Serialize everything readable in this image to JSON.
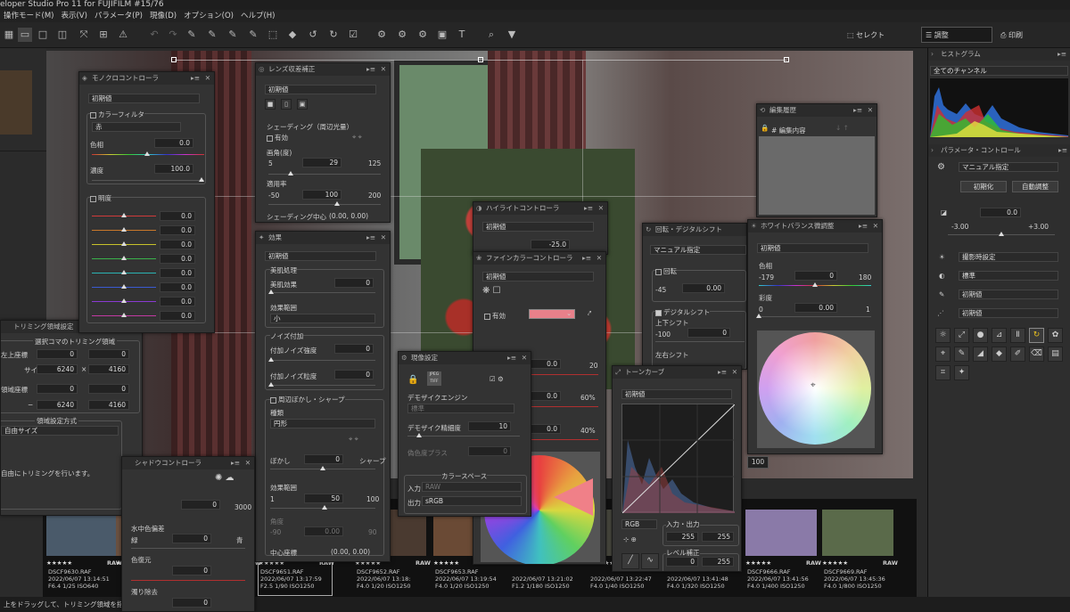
{
  "app": {
    "title": "eloper Studio Pro 11 for FUJIFILM  #15/76"
  },
  "menu": [
    "操作モード(M)",
    "表示(V)",
    "パラメータ(P)",
    "現像(D)",
    "オプション(O)",
    "ヘルプ(H)"
  ],
  "toolbar": {
    "select": "セレクト",
    "adjust": "調整",
    "print": "印刷"
  },
  "trim": {
    "title": "トリミング領域設定",
    "section": "選択コマのトリミング領域",
    "tl": "左上座標",
    "size": "サイズ",
    "tl_x": "0",
    "tl_y": "0",
    "w": "6240",
    "h": "4160",
    "area": "領域座標",
    "ax": "0",
    "ay": "0",
    "ax2": "6240",
    "ay2": "4160",
    "method_title": "領域設定方式",
    "method": "自由サイズ",
    "note": "自由にトリミングを行います。",
    "x": "×",
    "dash": "−"
  },
  "mono": {
    "title": "モノクロコントローラ",
    "preset": "初期値",
    "color_filter": "カラーフィルタ",
    "filter": "赤",
    "hue": "色相",
    "hue_v": "0.0",
    "density": "濃度",
    "density_v": "100.0",
    "brightness": "明度",
    "bvals": [
      "0.0",
      "0.0",
      "0.0",
      "0.0",
      "0.0",
      "0.0",
      "0.0",
      "0.0"
    ],
    "bcolors": [
      "#d03a3a",
      "#c8782a",
      "#c8c22a",
      "#3ab24a",
      "#2ab2b2",
      "#3a5ad2",
      "#8a3ad2",
      "#c23aa2"
    ]
  },
  "lens": {
    "title": "レンズ収差補正",
    "preset": "初期値",
    "shading": "シェーディング（周辺光量）",
    "enabled": "有効",
    "angle": "画角(度)",
    "min": "5",
    "val": "29",
    "max": "125",
    "rate": "適用率",
    "rmin": "-50",
    "rval": "100",
    "rmax": "200",
    "center": "シェーディング中心",
    "center_v": "(0.00, 0.00)"
  },
  "effect": {
    "title": "効果",
    "preset": "初期値",
    "skin": "美肌処理",
    "skin_effect": "美肌効果",
    "skin_v": "0",
    "skin_range": "効果範囲",
    "skin_range_v": "小",
    "noise": "ノイズ付加",
    "noise_str": "付加ノイズ強度",
    "noise_str_v": "0",
    "noise_gr": "付加ノイズ粒度",
    "noise_gr_v": "0",
    "blur": "周辺ぼかし・シャープ",
    "type": "種類",
    "type_v": "円形",
    "bokashi": "ぼかし",
    "sharp": "シャープ",
    "bv": "0",
    "range": "効果範囲",
    "r1": "1",
    "r50": "50",
    "r100": "100",
    "angle": "角度",
    "a1": "-90",
    "av": "0.00",
    "a2": "90",
    "center": "中心座標",
    "center_v": "(0.00, 0.00)"
  },
  "highlight": {
    "title": "ハイライトコントローラ",
    "preset": "初期値",
    "v": "-25.0"
  },
  "finecolor": {
    "title": "ファインカラーコントローラ",
    "preset": "初期値",
    "enabled": "有効",
    "swatch": "#e8808a",
    "v1": "0.0",
    "v1max": "20",
    "v2": "0.0",
    "v2max": "60%",
    "v3": "0.0",
    "v3max": "40%"
  },
  "develop": {
    "title": "現像設定",
    "demosaic": "デモザイクエンジン",
    "demosaic_v": "標準",
    "precision": "デモザイク精細度",
    "precision_v": "10",
    "false_color": "偽色度プラス",
    "false_color_v": "0",
    "colorspace": "カラースペース",
    "input": "入力",
    "input_v": "RAW",
    "output": "出力",
    "output_v": "sRGB",
    "jpeg": "JPEG TIFF"
  },
  "wb": {
    "title": "ホワイトバランス微調整",
    "preset": "初期値",
    "hue": "色相",
    "hmin": "-179",
    "hv": "0",
    "hmax": "180",
    "sat": "彩度",
    "smin": "0",
    "sv": "0.00",
    "smax": "1",
    "under": "100"
  },
  "rotate": {
    "title": "回転・デジタルシフト",
    "mode": "マニュアル指定",
    "rot": "回転",
    "rot_min": "-45",
    "rot_v": "0.00",
    "shift": "デジタルシフト",
    "ud": "上下シフト",
    "ud_min": "-100",
    "ud_v": "0",
    "lr": "左右シフト"
  },
  "curve": {
    "title": "トーンカーブ",
    "preset": "初期値",
    "channel": "RGB",
    "io": "入力・出力",
    "in_v": "255",
    "out_v": "255",
    "level": "レベル補正",
    "lv1": "0",
    "lv2": "255"
  },
  "history": {
    "title": "編集履歴",
    "col": "# 編集内容"
  },
  "shadow": {
    "title": "シャドウコントローラ",
    "min": "0",
    "max": "3000",
    "hue": "水中色偏差",
    "green": "緑",
    "blue": "青",
    "v1": "0",
    "v2": "0",
    "color": "色復元",
    "noise": "濁り除去",
    "v3": "0",
    "v4": "0"
  },
  "histogram": {
    "title": "ヒストグラム",
    "channel": "全てのチャンネル"
  },
  "params": {
    "title": "パラメータ・コントロール",
    "mode": "マニュアル指定",
    "init": "初期化",
    "auto": "自動調整",
    "exp": "0.0",
    "exp_min": "-3.00",
    "exp_max": "+3.00",
    "shooting": "撮影時設定",
    "std": "標準",
    "init2": "初期値",
    "init3": "初期値"
  },
  "thumbs": [
    {
      "name": "DSCF9630.RAF",
      "date": "2022/06/07 13:14:51",
      "exif": "F6.4 1/25 ISO640",
      "color": "#4a5a6a"
    },
    {
      "name": "",
      "date": "",
      "exif": "",
      "color": "#6a5040"
    },
    {
      "name": "",
      "date": "",
      "exif": "",
      "color": "#3a4a5a"
    },
    {
      "name": "DSCF9651.RAF",
      "date": "2022/06/07 13:17:59",
      "exif": "F2.5 1/90 ISO1250",
      "color": "#5a4035"
    },
    {
      "name": "DSCF9652.RAF",
      "date": "2022/06/07 13:18:",
      "exif": "F4.0 1/20 ISO1250",
      "color": "#4a3a30"
    },
    {
      "name": "DSCF9653.RAF",
      "date": "2022/06/07 13:19:54",
      "exif": "F4.0 1/20 ISO1250",
      "color": "#6a4a35"
    },
    {
      "name": "",
      "date": "2022/06/07 13:21:02",
      "exif": "F1.2 1/180 ISO1250",
      "color": "#5a5040"
    },
    {
      "name": "",
      "date": "2022/06/07 13:22:47",
      "exif": "F4.0 1/40 ISO1250",
      "color": "#4a4a40"
    },
    {
      "name": "",
      "date": "2022/06/07 13:41:48",
      "exif": "F4.0 1/320 ISO1250",
      "color": "#4a5a40"
    },
    {
      "name": "DSCF9666.RAF",
      "date": "2022/06/07 13:41:56",
      "exif": "F4.0 1/400 ISO1250",
      "color": "#8a7aa8"
    },
    {
      "name": "DSCF9669.RAF",
      "date": "2022/06/07 13:45:36",
      "exif": "F4.0 1/800 ISO1250",
      "color": "#5a6a4a"
    }
  ],
  "thumb_partial": {
    "a": "31",
    "b": "1250"
  },
  "stars": "★★★★★",
  "raw": "RAW",
  "status": {
    "text": "上をドラッグして、トリミング領域を指定してくださ"
  }
}
